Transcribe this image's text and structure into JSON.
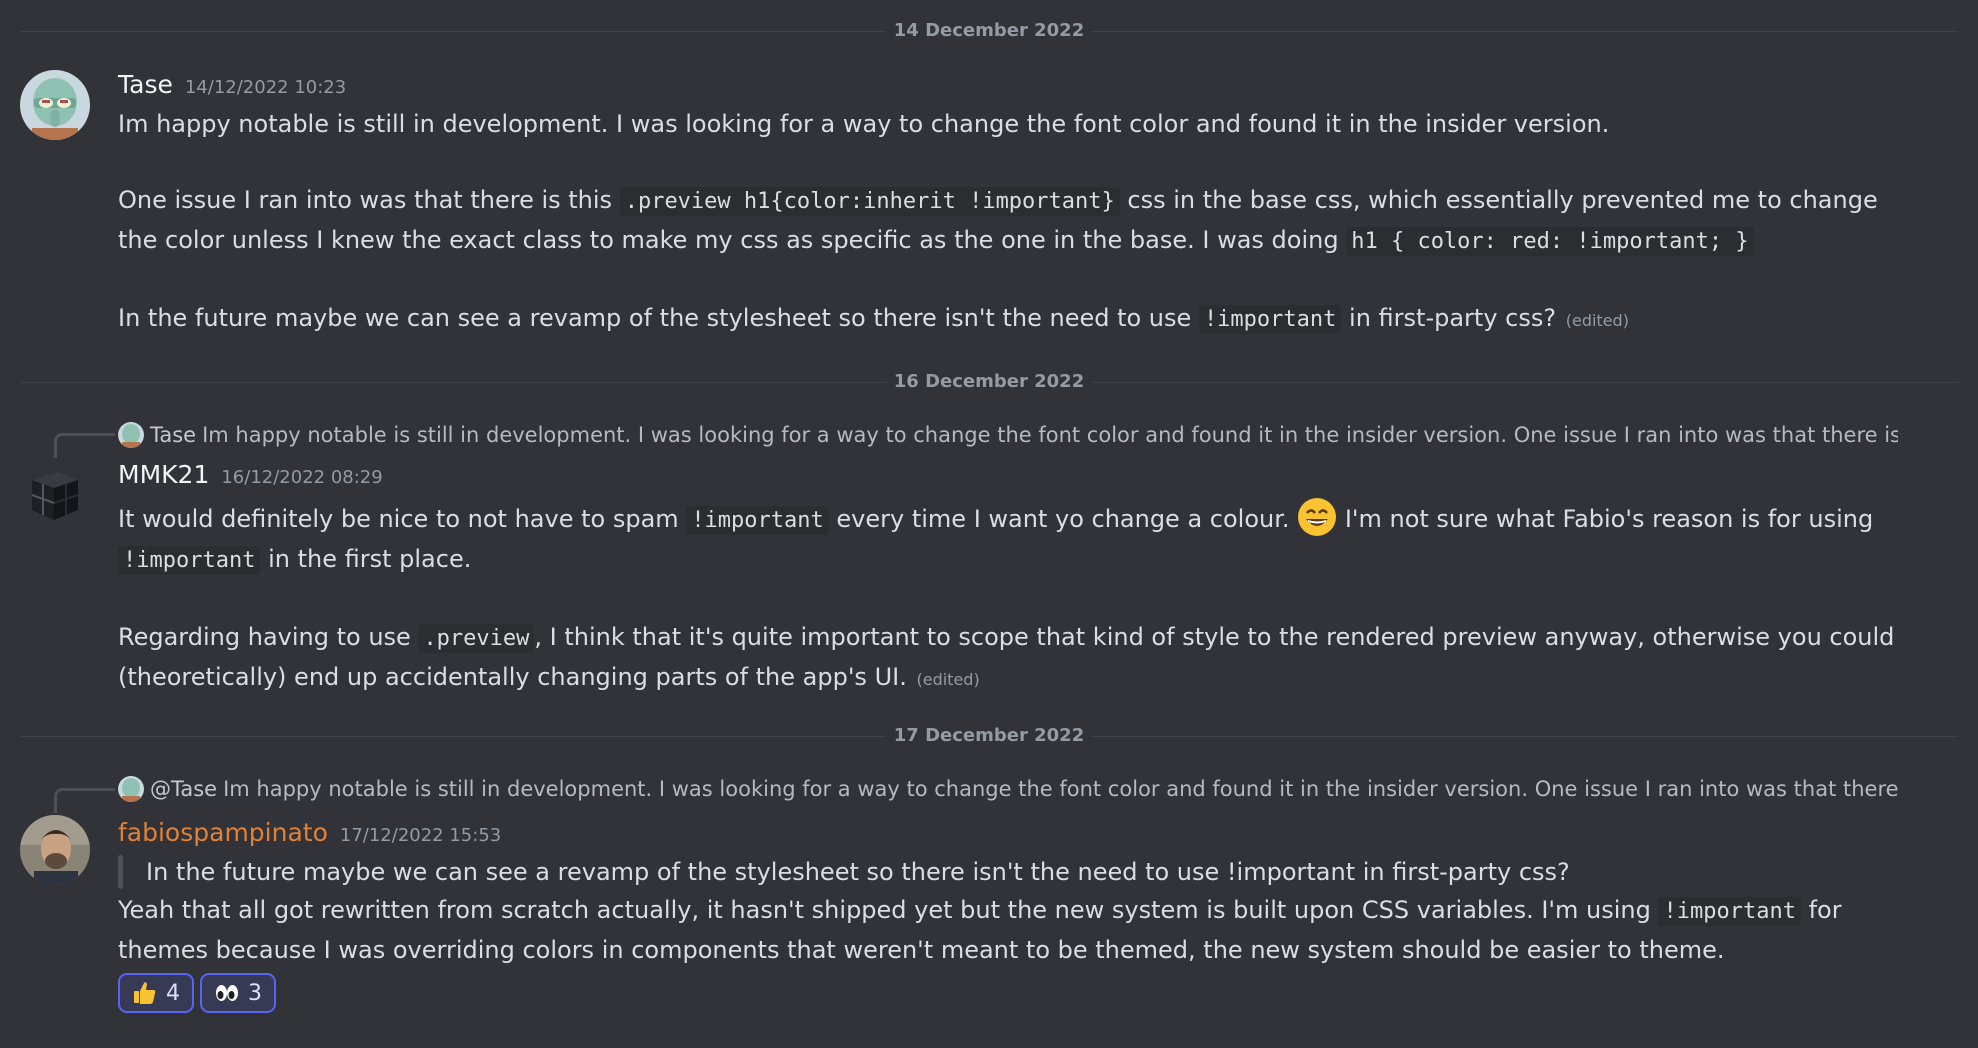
{
  "dividers": [
    "14 December 2022",
    "16 December 2022",
    "17 December 2022"
  ],
  "messages": [
    {
      "author": "Tase",
      "timestamp": "14/12/2022 10:23",
      "avatar": "squidward-avatar",
      "lines": {
        "l1": "Im happy notable is still in development. I was looking for a way to change the font color and found it in the insider version.",
        "l2a": "One issue I ran into was that there is this",
        "l2code": ".preview h1{color:inherit !important}",
        "l2b": "css in the base css, which essentially prevented me to change",
        "l3a": "the color unless I knew the exact class to make my css as specific as the one in the base. I was doing",
        "l3code": "h1 { color: red: !important; }",
        "l4a": "In the future maybe we can see a revamp of the stylesheet so there isn't the need to use",
        "l4code": "!important",
        "l4b": "in first-party css?",
        "edited": "(edited)"
      }
    },
    {
      "author": "MMK21",
      "timestamp": "16/12/2022 08:29",
      "avatar": "cube-avatar",
      "reply": {
        "name": "Tase",
        "text": "Im happy notable is still in development. I was looking for a way to change the font color and found it in the insider version. One issue I ran into was that there is this"
      },
      "lines": {
        "l1a": "It would definitely be nice to not have to spam",
        "l1code": "!important",
        "l1b": "every time I want yo change a colour.",
        "l1emoji": "grinning-emoji",
        "l1c": "I'm not sure what  Fabio's reason is for using",
        "l2code": "!important",
        "l2b": "in the first place.",
        "l3a": "Regarding having to use",
        "l3code": ".preview",
        "l3b": ", I think that it's quite important to scope that kind of style to the rendered preview anyway, otherwise you could",
        "l4a": "(theoretically) end up accidentally changing parts of the app's UI.",
        "edited": "(edited)"
      }
    },
    {
      "author": "fabiospampinato",
      "timestamp": "17/12/2022 15:53",
      "avatar": "person-avatar",
      "author_color": "#e08137",
      "reply": {
        "name": "@Tase",
        "text": "Im happy notable is still in development. I was looking for a way to change the font color and found it in the insider version. One issue I ran into was that there is th"
      },
      "lines": {
        "quote": "In the future maybe we can see a revamp of the stylesheet so there isn't the need to use !important in first-party css?",
        "l1a": "Yeah that all got rewritten from scratch actually, it hasn't shipped yet but the new system is built upon CSS variables. I'm using",
        "l1code": "!important",
        "l1b": "for",
        "l2a": "themes because I was overriding colors in components that weren't meant to be themed, the new system should be easier to theme."
      },
      "reactions": [
        {
          "emoji": "thumbs-up-icon",
          "count": "4"
        },
        {
          "emoji": "eyes-icon",
          "count": "3"
        }
      ]
    }
  ]
}
